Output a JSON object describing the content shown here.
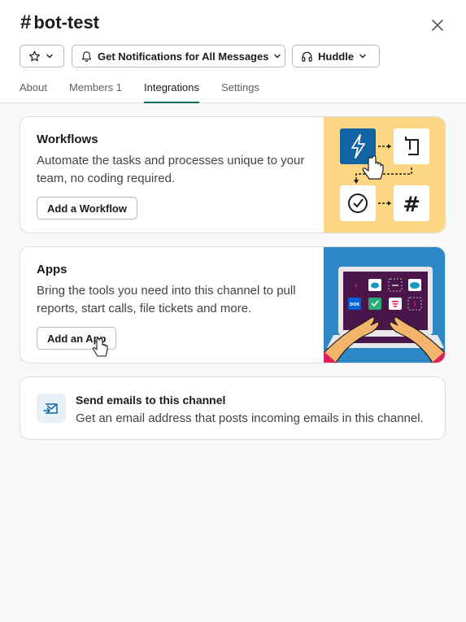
{
  "header": {
    "channel_hash": "#",
    "channel_name": "bot-test",
    "notifications_label": "Get Notifications for All Messages",
    "huddle_label": "Huddle"
  },
  "tabs": [
    {
      "label": "About"
    },
    {
      "label": "Members 1"
    },
    {
      "label": "Integrations",
      "active": true
    },
    {
      "label": "Settings"
    }
  ],
  "workflows": {
    "title": "Workflows",
    "description": "Automate the tasks and processes unique to your team, no coding required.",
    "button_label": "Add a Workflow",
    "art_bg": "#fcd683",
    "art_step_symbol": "#"
  },
  "apps": {
    "title": "Apps",
    "description": "Bring the tools you need into this channel to pull reports, start calls, file tickets and more.",
    "button_label": "Add an App",
    "art_bg": "#2e87c5",
    "art_app_label": "DOX"
  },
  "email": {
    "title": "Send emails to this channel",
    "description": "Get an email address that posts incoming emails in this channel."
  },
  "colors": {
    "accent_tab": "#0f6e5b",
    "border": "#dddddd",
    "text": "#1d1c1d",
    "muted": "#616061"
  },
  "icons": [
    "star-icon",
    "chevron-down-icon",
    "bell-icon",
    "headphones-icon",
    "close-icon",
    "email-icon",
    "hand-cursor-icon"
  ]
}
